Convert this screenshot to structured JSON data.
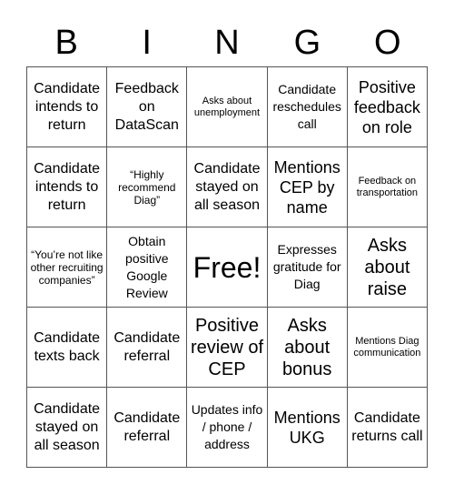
{
  "header": {
    "letters": [
      "B",
      "I",
      "N",
      "G",
      "O"
    ]
  },
  "cells": [
    [
      "Candidate intends to return",
      "Feedback on DataScan",
      "Asks about unemployment",
      "Candidate reschedules call",
      "Positive feedback on role"
    ],
    [
      "Candidate intends to return",
      "“Highly recommend Diag”",
      "Candidate stayed on all season",
      "Mentions CEP by name",
      "Feedback on transportation"
    ],
    [
      "“You’re not like other recruiting companies”",
      "Obtain positive Google Review",
      "Free!",
      "Expresses gratitude for Diag",
      "Asks about raise"
    ],
    [
      "Candidate texts back",
      "Candidate referral",
      "Positive review of CEP",
      "Asks about bonus",
      "Mentions Diag communication"
    ],
    [
      "Candidate stayed on all season",
      "Candidate referral",
      "Updates info / phone / address",
      "Mentions UKG",
      "Candidate returns call"
    ]
  ]
}
